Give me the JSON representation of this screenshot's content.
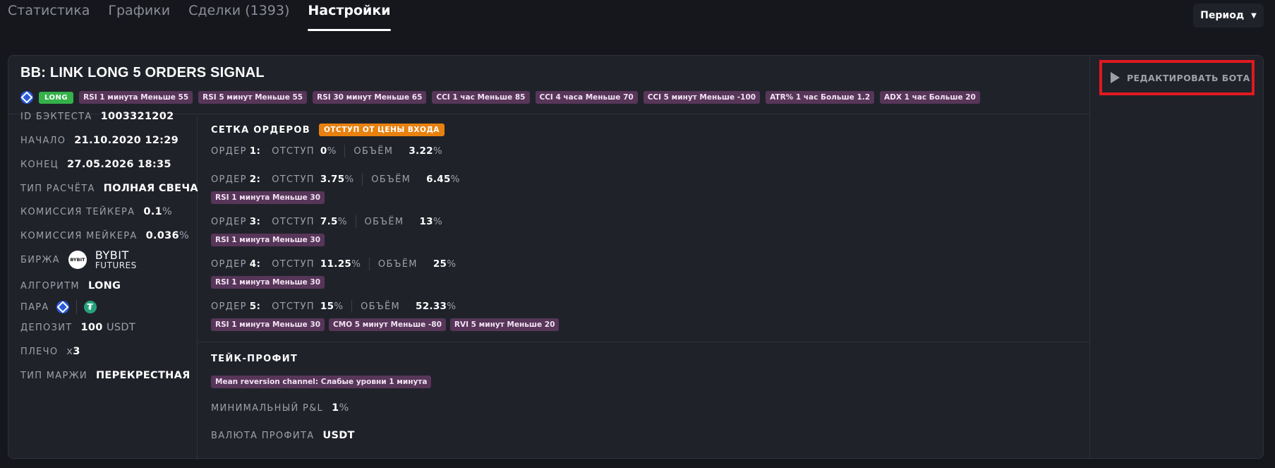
{
  "tabs": [
    {
      "label": "Статистика"
    },
    {
      "label": "Графики"
    },
    {
      "label": "Сделки (1393)"
    },
    {
      "label": "Настройки"
    }
  ],
  "period": {
    "label": "Период"
  },
  "bot": {
    "title": "BB: LINK LONG 5 ORDERS SIGNAL",
    "direction_badge": "LONG",
    "conditions": [
      "RSI 1 минута Меньше 55",
      "RSI 5 минут Меньше 55",
      "RSI 30 минут Меньше 65",
      "CCI 1 час Меньше 85",
      "CCI 4 часа Меньше 70",
      "CCI 5 минут Меньше -100",
      "ATR% 1 час Больше 1.2",
      "ADX 1 час Больше 20"
    ],
    "edit_label": "РЕДАКТИРОВАТЬ БОТА"
  },
  "info": {
    "id": {
      "label": "ID БЭКТЕСТА",
      "value": "1003321202"
    },
    "start": {
      "label": "НАЧАЛО",
      "value": "21.10.2020 12:29"
    },
    "end": {
      "label": "КОНЕЦ",
      "value": "27.05.2026 18:35"
    },
    "calc": {
      "label": "ТИП РАСЧЁТА",
      "value": "ПОЛНАЯ СВЕЧА"
    },
    "taker": {
      "label": "КОМИССИЯ ТЕЙКЕРА",
      "value": "0.1",
      "unit": "%"
    },
    "maker": {
      "label": "КОМИССИЯ МЕЙКЕРА",
      "value": "0.036",
      "unit": "%"
    },
    "exchange": {
      "label": "БИРЖА",
      "logo_text": "BYBIT",
      "name": "BYBIT",
      "sub": "FUTURES"
    },
    "algo": {
      "label": "АЛГОРИТМ",
      "value": "LONG"
    },
    "pair": {
      "label": "ПАРА",
      "quote_symbol": "₮"
    },
    "deposit": {
      "label": "ДЕПОЗИТ",
      "value": "100",
      "unit": "USDT"
    },
    "leverage": {
      "label": "ПЛЕЧО",
      "prefix": "x",
      "value": "3"
    },
    "margin": {
      "label": "ТИП МАРЖИ",
      "value": "ПЕРЕКРЕСТНАЯ"
    }
  },
  "grid": {
    "title": "СЕТКА ОРДЕРОВ",
    "badge": "ОТСТУП ОТ ЦЕНЫ ВХОДА",
    "offset_label": "ОТСТУП",
    "volume_label": "ОБЪЁМ",
    "pct": "%",
    "orders": [
      {
        "label": "ОРДЕР",
        "num": "1:",
        "offset": "0",
        "volume": "3.22",
        "conditions": []
      },
      {
        "label": "ОРДЕР",
        "num": "2:",
        "offset": "3.75",
        "volume": "6.45",
        "conditions": [
          "RSI 1 минута Меньше 30"
        ]
      },
      {
        "label": "ОРДЕР",
        "num": "3:",
        "offset": "7.5",
        "volume": "13",
        "conditions": [
          "RSI 1 минута Меньше 30"
        ]
      },
      {
        "label": "ОРДЕР",
        "num": "4:",
        "offset": "11.25",
        "volume": "25",
        "conditions": [
          "RSI 1 минута Меньше 30"
        ]
      },
      {
        "label": "ОРДЕР",
        "num": "5:",
        "offset": "15",
        "volume": "52.33",
        "conditions": [
          "RSI 1 минута Меньше 30",
          "CMO 5 минут Меньше -80",
          "RVI 5 минут Меньше 20"
        ]
      }
    ]
  },
  "take_profit": {
    "title": "ТЕЙК-ПРОФИТ",
    "condition": "Mean reversion channel: Слабые уровни 1 минута",
    "min_pnl": {
      "label": "МИНИМАЛЬНЫЙ P&L",
      "value": "1",
      "unit": "%"
    },
    "currency": {
      "label": "ВАЛЮТА ПРОФИТА",
      "value": "USDT"
    }
  },
  "colors": {
    "background": "#16171c",
    "card": "#20222a",
    "long_badge": "#35b24a",
    "condition_tag": "#573659",
    "orange_badge": "#e8810f",
    "highlight_border": "#e0191f"
  }
}
